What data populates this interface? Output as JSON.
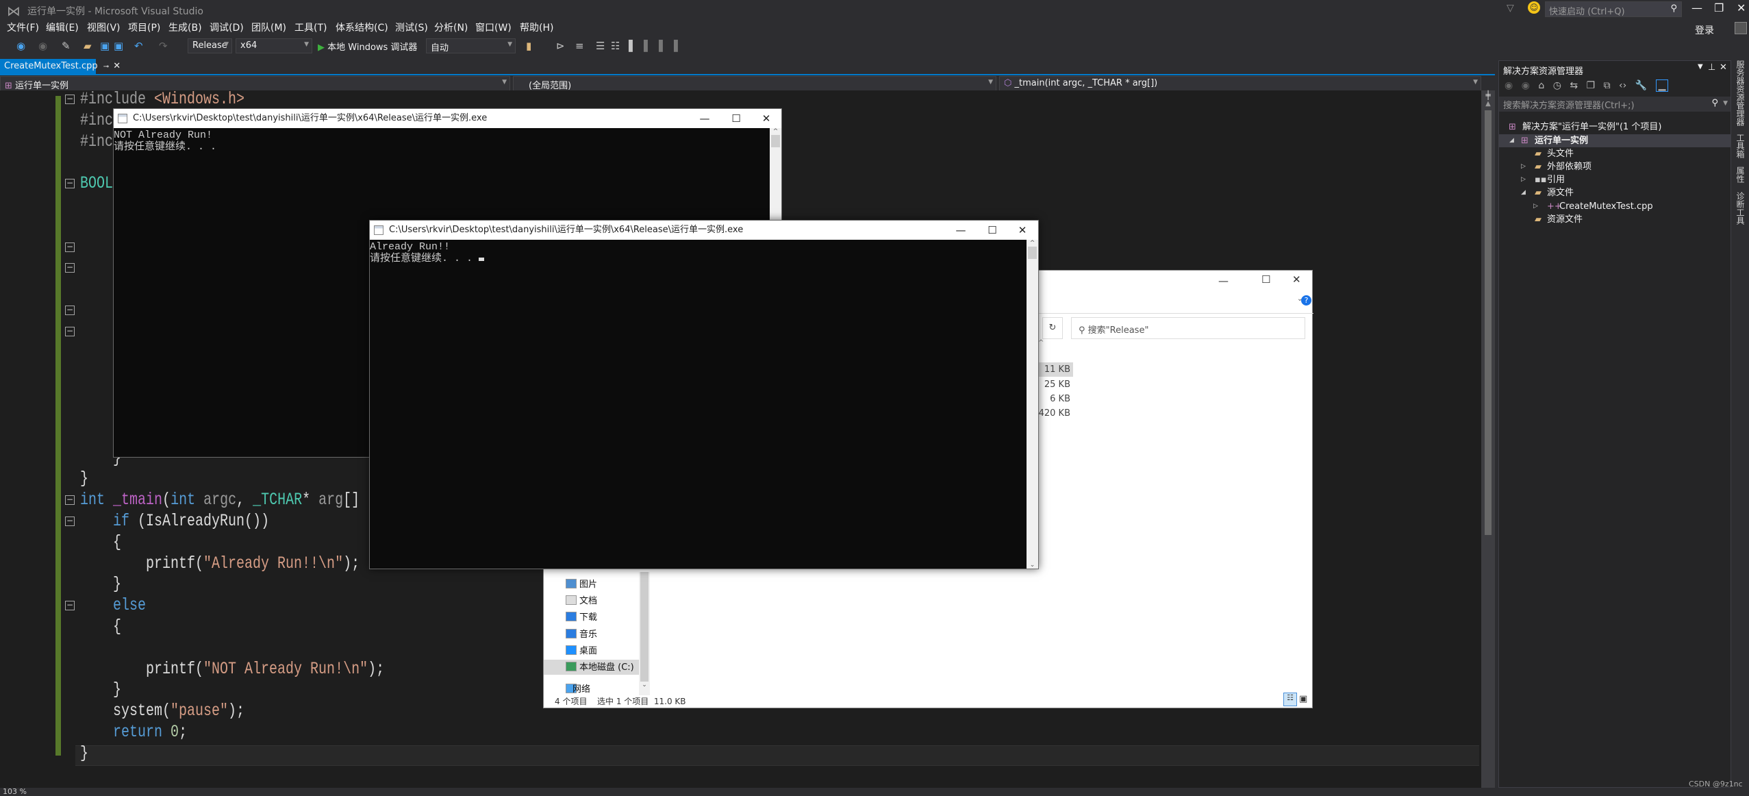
{
  "window": {
    "title": "运行单一实例 - Microsoft Visual Studio",
    "quick_launch_placeholder": "快速启动 (Ctrl+Q)",
    "sign_in": "登录"
  },
  "menu": [
    "文件(F)",
    "编辑(E)",
    "视图(V)",
    "项目(P)",
    "生成(B)",
    "调试(D)",
    "团队(M)",
    "工具(T)",
    "体系结构(C)",
    "测试(S)",
    "分析(N)",
    "窗口(W)",
    "帮助(H)"
  ],
  "toolbar": {
    "config": "Release",
    "platform": "x64",
    "debugger": "本地 Windows 调试器",
    "debug_mode": "自动"
  },
  "tabs": [
    {
      "label": "CreateMutexTest.cpp",
      "active": true
    }
  ],
  "navbar": {
    "project": "运行单一实例",
    "scope": "(全局范围)",
    "member": "_tmain(int argc, _TCHAR * arg[])"
  },
  "editor": {
    "zoom": "103 %",
    "lines": [
      [
        [
          "#include ",
          "pp"
        ],
        [
          "<Windows.h>",
          "str"
        ]
      ],
      [
        [
          "#inc",
          "pp"
        ]
      ],
      [
        [
          "#inc",
          "pp"
        ]
      ],
      [],
      [
        [
          "BOOL",
          "ty"
        ]
      ],
      [],
      [],
      [],
      [],
      [],
      [],
      [],
      [],
      [],
      [],
      [],
      [],
      [
        [
          "    }",
          "pl"
        ]
      ],
      [
        [
          "}",
          "pl"
        ]
      ],
      [
        [
          "int",
          "kw"
        ],
        [
          " ",
          "pl"
        ],
        [
          "_tmain",
          "fn"
        ],
        [
          "(",
          "pl"
        ],
        [
          "int",
          "kw"
        ],
        [
          " ",
          "pl"
        ],
        [
          "argc",
          "par"
        ],
        [
          ", ",
          "pl"
        ],
        [
          "_TCHAR",
          "ty"
        ],
        [
          "* ",
          "pl"
        ],
        [
          "arg",
          "par"
        ],
        [
          "[]",
          "pl"
        ]
      ],
      [
        [
          "    ",
          "pl"
        ],
        [
          "if",
          "kw"
        ],
        [
          " (IsAlreadyRun())",
          "pl"
        ]
      ],
      [
        [
          "    {",
          "pl"
        ]
      ],
      [
        [
          "        printf(",
          "pl"
        ],
        [
          "\"Already Run!!\\n\"",
          "str"
        ],
        [
          ");",
          "pl"
        ]
      ],
      [
        [
          "    }",
          "pl"
        ]
      ],
      [
        [
          "    ",
          "pl"
        ],
        [
          "else",
          "kw"
        ]
      ],
      [
        [
          "    {",
          "pl"
        ]
      ],
      [],
      [
        [
          "        printf(",
          "pl"
        ],
        [
          "\"NOT Already Run!\\n\"",
          "str"
        ],
        [
          ");",
          "pl"
        ]
      ],
      [
        [
          "    }",
          "pl"
        ]
      ],
      [
        [
          "    system(",
          "pl"
        ],
        [
          "\"pause\"",
          "str"
        ],
        [
          ");",
          "pl"
        ]
      ],
      [
        [
          "    ",
          "pl"
        ],
        [
          "return",
          "kw"
        ],
        [
          " ",
          "pl"
        ],
        [
          "0",
          "num"
        ],
        [
          ";",
          "pl"
        ]
      ],
      [
        [
          "}",
          "pl"
        ]
      ]
    ],
    "fold_lines": [
      0,
      4,
      7,
      8,
      10,
      11,
      19,
      20,
      24
    ]
  },
  "console1": {
    "title": "C:\\Users\\rkvir\\Desktop\\test\\danyishili\\运行单一实例\\x64\\Release\\运行单一实例.exe",
    "output": [
      "NOT Already Run!",
      "请按任意键继续. . ."
    ]
  },
  "console2": {
    "title": "C:\\Users\\rkvir\\Desktop\\test\\danyishili\\运行单一实例\\x64\\Release\\运行单一实例.exe",
    "output": [
      "Already Run!!",
      "请按任意键继续. . . "
    ]
  },
  "explorer": {
    "search_placeholder": "搜索\"Release\"",
    "sizes": [
      "11 KB",
      "25 KB",
      "6 KB",
      "420 KB"
    ],
    "nav": [
      "图片",
      "文档",
      "下载",
      "音乐",
      "桌面",
      "本地磁盘 (C:)",
      "网络"
    ],
    "status": {
      "count": "4 个项目",
      "selected": "选中 1 个项目  11.0 KB"
    }
  },
  "solution_explorer": {
    "title": "解决方案资源管理器",
    "search_placeholder": "搜索解决方案资源管理器(Ctrl+;)",
    "items": [
      {
        "label": "解决方案\"运行单一实例\"(1 个项目)",
        "icon": "solution-icon"
      },
      {
        "label": "运行单一实例",
        "icon": "project-icon",
        "selected": true
      },
      {
        "label": "头文件",
        "icon": "folder-icon"
      },
      {
        "label": "外部依赖项",
        "icon": "folder-icon"
      },
      {
        "label": "引用",
        "icon": "references-icon"
      },
      {
        "label": "源文件",
        "icon": "folder-icon"
      },
      {
        "label": "CreateMutexTest.cpp",
        "icon": "cpp-file-icon"
      },
      {
        "label": "资源文件",
        "icon": "folder-icon"
      }
    ]
  },
  "side_tabs": [
    "服务器资源管理器",
    "工具箱",
    "属性",
    "诊断工具"
  ],
  "watermark": "CSDN @9z1nc",
  "colors": {
    "accent": "#007acc",
    "editor_bg": "#1e1e1e",
    "change_bar": "#57792a"
  }
}
